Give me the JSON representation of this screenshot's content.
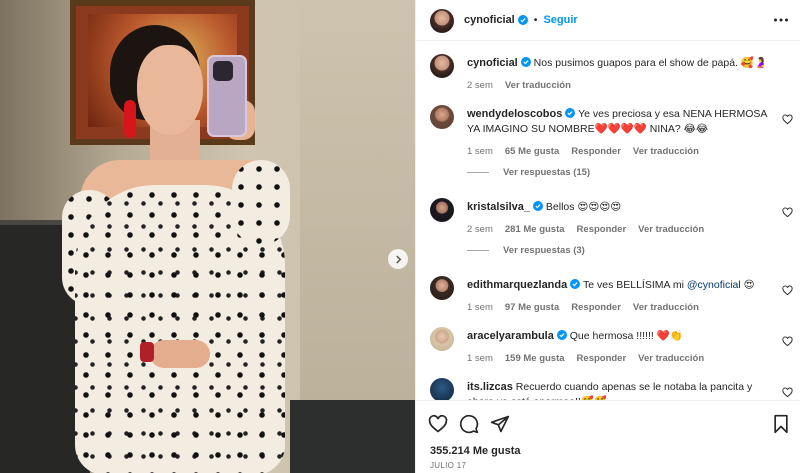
{
  "post": {
    "username": "cynoficial",
    "follow_label": "Seguir",
    "caption": "Nos pusimos guapos para el show de papá. 🥰🤰",
    "caption_time": "2 sem",
    "caption_translate": "Ver traducción",
    "likes": "355.214 Me gusta",
    "date": "JULIO 17"
  },
  "comments": [
    {
      "username": "wendydeloscobos",
      "text": "Ye ves preciosa y esa NENA HERMOSA YA IMAGINO SU NOMBRE❤️❤️❤️❤️ NINA? 😂😂",
      "time": "1 sem",
      "likes": "65 Me gusta",
      "reply": "Responder",
      "translate": "Ver traducción",
      "view_replies": "Ver respuestas (15)"
    },
    {
      "username": "kristalsilva_",
      "text": "Bellos 😍😍😍😍",
      "time": "2 sem",
      "likes": "281 Me gusta",
      "reply": "Responder",
      "translate": "Ver traducción",
      "view_replies": "Ver respuestas (3)"
    },
    {
      "username": "edithmarquezlanda",
      "text_before": "Te ves BELLÍSIMA mi ",
      "mention": "@cynoficial",
      "text_after": " 😍",
      "time": "1 sem",
      "likes": "97 Me gusta",
      "reply": "Responder",
      "translate": "Ver traducción"
    },
    {
      "username": "aracelyarambula",
      "text": "Que hermosa !!!!!! ❤️👏",
      "time": "1 sem",
      "likes": "159 Me gusta",
      "reply": "Responder",
      "translate": "Ver traducción"
    },
    {
      "username": "its.lizcas",
      "text": "Recuerdo cuando apenas se le notaba la pancita y ahora ya está enormee!!🥰🥰"
    }
  ],
  "colors": {
    "accent_blue": "#0095f6",
    "verified_blue": "#0095f6",
    "text_primary": "#262626",
    "text_secondary": "#737373"
  },
  "icons": [
    "more-options-icon",
    "verified-badge-icon",
    "heart-icon",
    "comment-icon",
    "share-icon",
    "save-bookmark-icon",
    "carousel-next-icon"
  ]
}
